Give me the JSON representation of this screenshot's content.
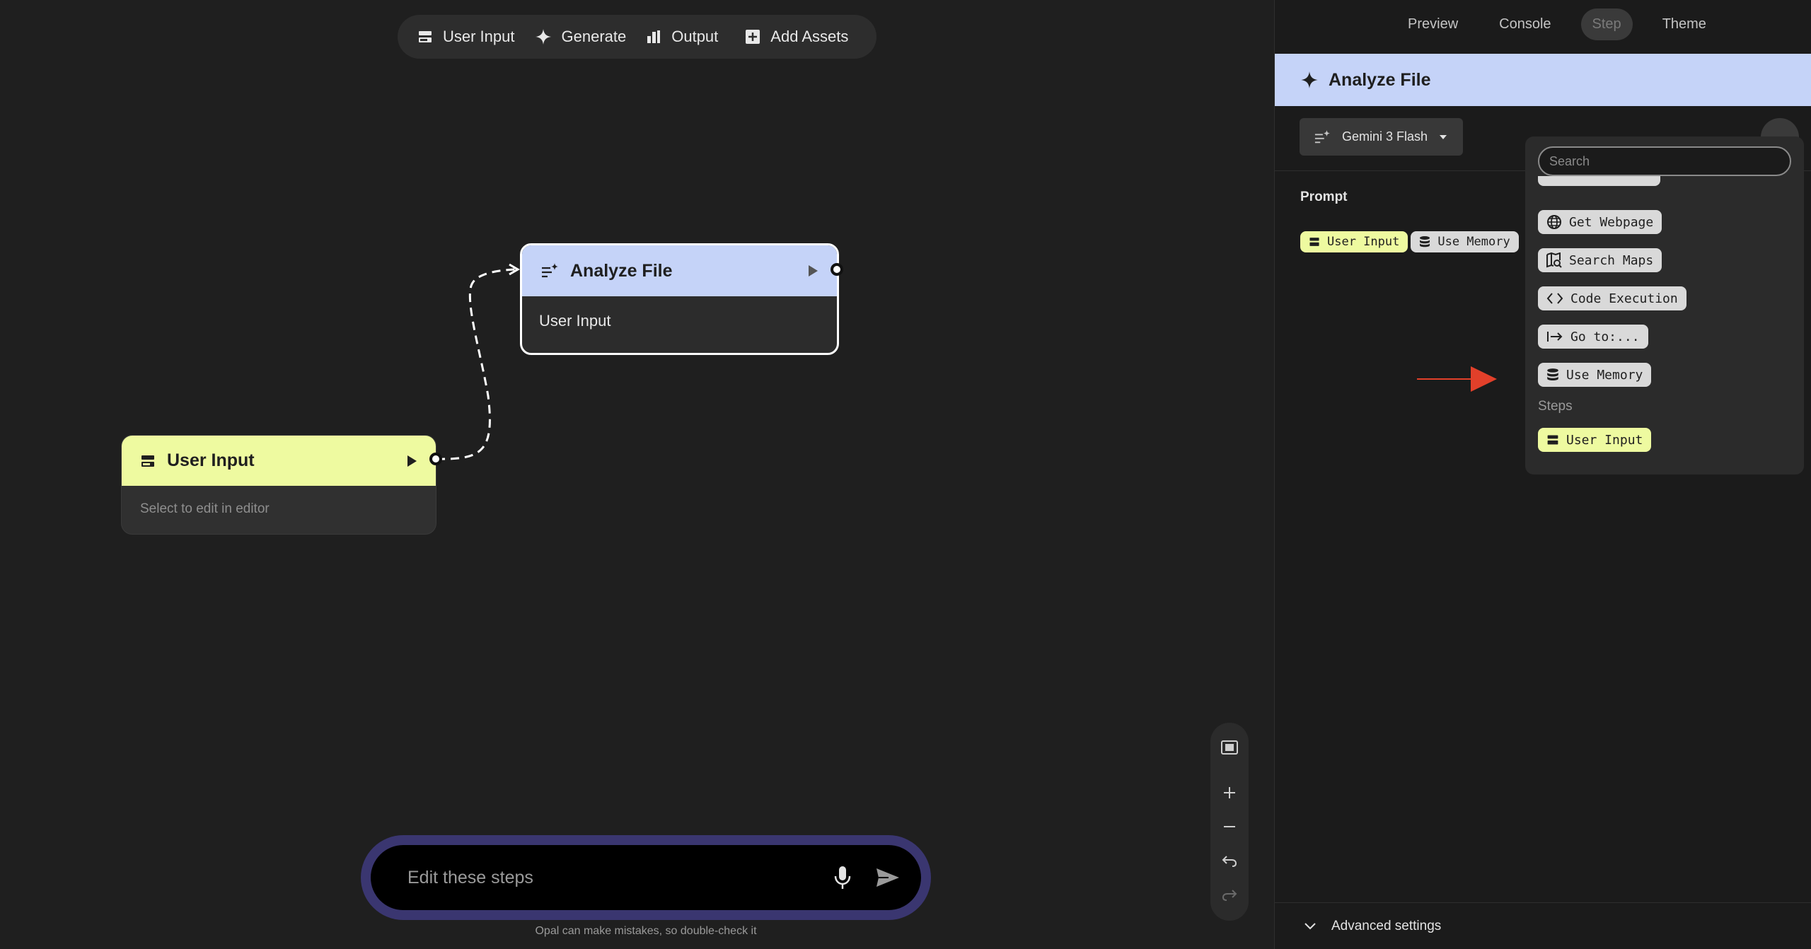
{
  "toolbar": {
    "user_input": "User Input",
    "generate": "Generate",
    "output": "Output",
    "add_assets": "Add Assets"
  },
  "nodes": {
    "user_input": {
      "title": "User Input",
      "body": "Select to edit in editor"
    },
    "analyze_file": {
      "title": "Analyze File",
      "body": "User Input"
    }
  },
  "chat": {
    "placeholder": "Edit these steps",
    "disclaimer": "Opal can make mistakes, so double-check it"
  },
  "panel": {
    "tabs": [
      "Preview",
      "Console",
      "Step",
      "Theme"
    ],
    "active_tab": "Step",
    "step_title": "Analyze File",
    "model": "Gemini 3 Flash",
    "prompt_label": "Prompt",
    "prompt_chips": [
      "User Input",
      "Use Memory"
    ],
    "advanced": "Advanced settings"
  },
  "dropdown": {
    "search_placeholder": "Search",
    "tools": [
      "Get Webpage",
      "Search Maps",
      "Code Execution",
      "Go to:...",
      "Use Memory"
    ],
    "steps_label": "Steps",
    "steps": [
      "User Input"
    ]
  },
  "colors": {
    "user_input_accent": "#eefaa0",
    "generate_accent": "#c5d3f8",
    "chat_border": "#3a3670",
    "annotation_arrow": "#e2402a"
  }
}
